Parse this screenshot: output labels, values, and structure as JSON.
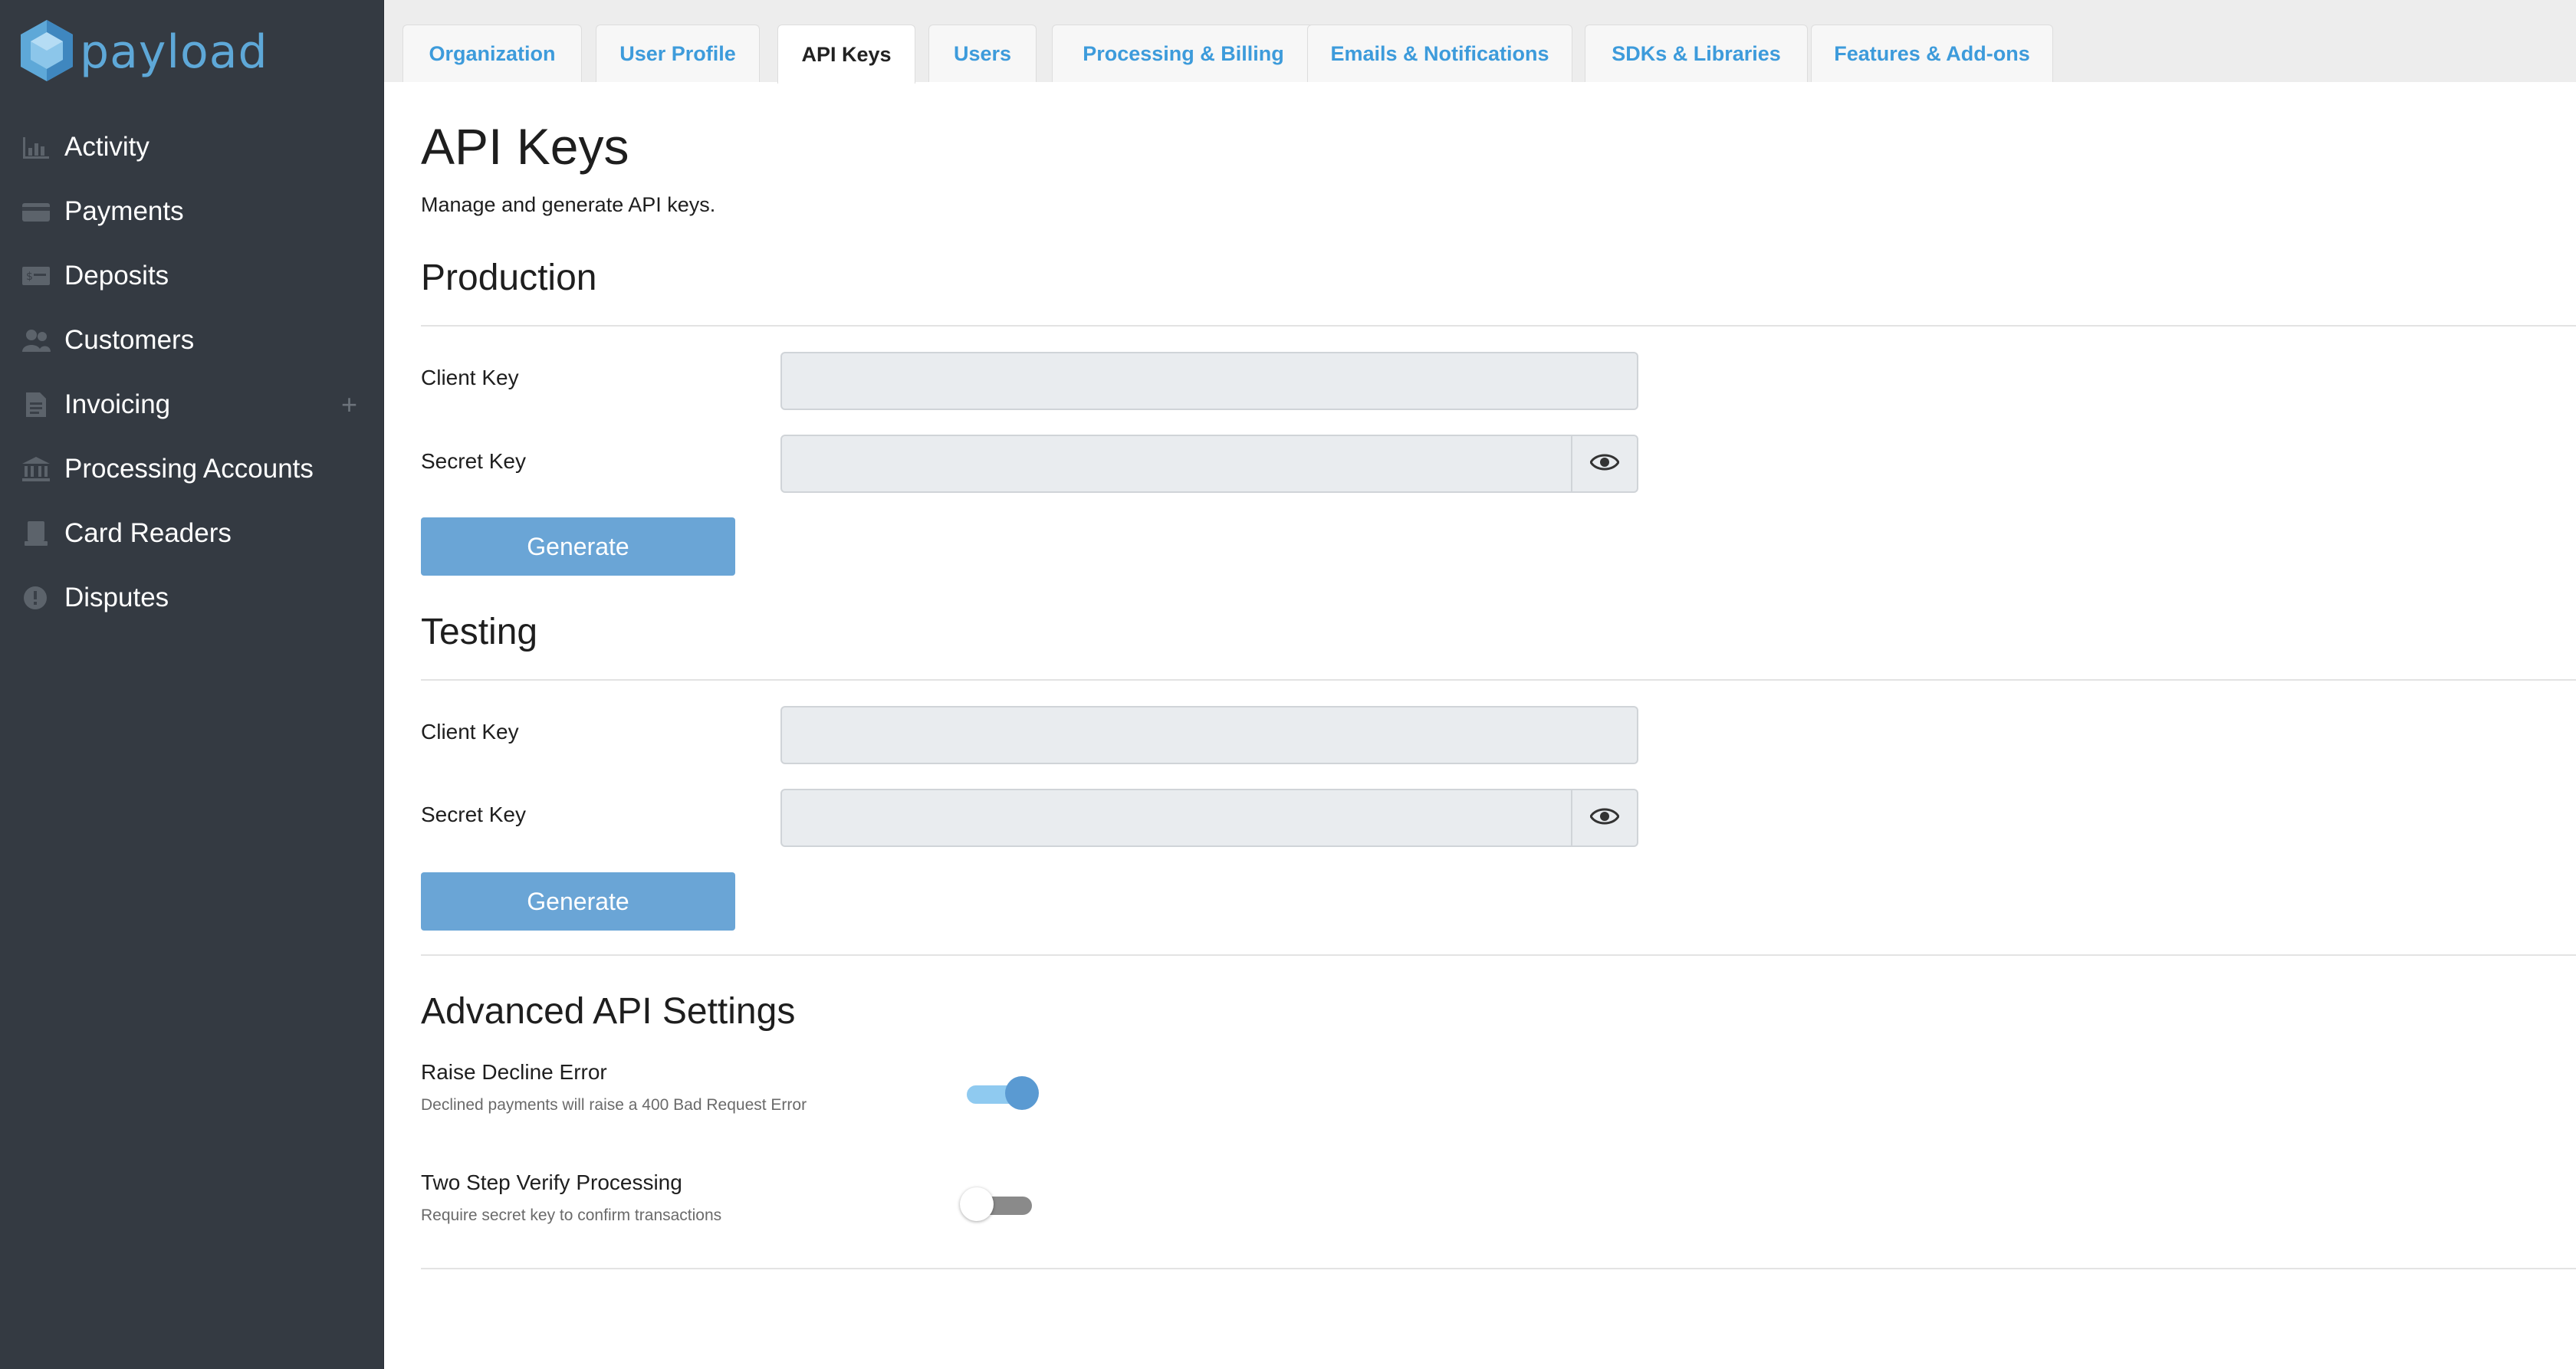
{
  "app": {
    "logo_text": "payload",
    "accent_color": "#3d9bdb"
  },
  "sidebar": {
    "items": [
      {
        "label": "Activity",
        "icon": "bar-chart-icon"
      },
      {
        "label": "Payments",
        "icon": "credit-card-icon"
      },
      {
        "label": "Deposits",
        "icon": "cash-icon"
      },
      {
        "label": "Customers",
        "icon": "users-icon"
      },
      {
        "label": "Invoicing",
        "icon": "document-icon",
        "action": "+"
      },
      {
        "label": "Processing Accounts",
        "icon": "bank-icon"
      },
      {
        "label": "Card Readers",
        "icon": "card-reader-icon"
      },
      {
        "label": "Disputes",
        "icon": "alert-circle-icon"
      }
    ]
  },
  "tabs": [
    {
      "label": "Organization",
      "active": false
    },
    {
      "label": "User Profile",
      "active": false
    },
    {
      "label": "API Keys",
      "active": true
    },
    {
      "label": "Users",
      "active": false
    },
    {
      "label": "Processing & Billing",
      "active": false
    },
    {
      "label": "Emails & Notifications",
      "active": false
    },
    {
      "label": "SDKs & Libraries",
      "active": false
    },
    {
      "label": "Features & Add-ons",
      "active": false
    }
  ],
  "page": {
    "title": "API Keys",
    "subtitle": "Manage and generate API keys."
  },
  "production": {
    "heading": "Production",
    "client_key_label": "Client Key",
    "client_key_value": "",
    "secret_key_label": "Secret Key",
    "secret_key_value": "",
    "generate_label": "Generate"
  },
  "testing": {
    "heading": "Testing",
    "client_key_label": "Client Key",
    "client_key_value": "",
    "secret_key_label": "Secret Key",
    "secret_key_value": "",
    "generate_label": "Generate"
  },
  "advanced": {
    "heading": "Advanced API Settings",
    "settings": [
      {
        "title": "Raise Decline Error",
        "description": "Declined payments will raise a 400 Bad Request Error",
        "enabled": true
      },
      {
        "title": "Two Step Verify Processing",
        "description": "Require secret key to confirm transactions",
        "enabled": false
      }
    ]
  }
}
